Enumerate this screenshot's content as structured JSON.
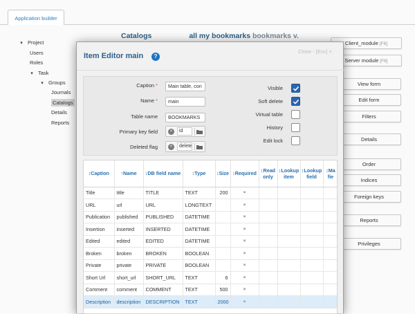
{
  "app": {
    "tab_label": "Application builder"
  },
  "tree": {
    "items": [
      {
        "label": "Project",
        "toggle": "▾",
        "level": 0
      },
      {
        "label": "Users",
        "toggle": "",
        "level": 1
      },
      {
        "label": "Roles",
        "toggle": "",
        "level": 1
      },
      {
        "label": "Task",
        "toggle": "▾",
        "level": 1
      },
      {
        "label": "Groups",
        "toggle": "▾",
        "level": 2
      },
      {
        "label": "Journals",
        "toggle": "",
        "level": 3
      },
      {
        "label": "Catalogs",
        "toggle": "",
        "level": 3,
        "selected": true
      },
      {
        "label": "Details",
        "toggle": "",
        "level": 3
      },
      {
        "label": "Reports",
        "toggle": "",
        "level": 3
      }
    ]
  },
  "catalog_header": {
    "title": "Catalogs",
    "caption": "all my bookmarks",
    "name": "bookmarks v."
  },
  "right_buttons": [
    {
      "label": "Client_module",
      "key": "[F8]"
    },
    {
      "label": "Server module",
      "key": "[F8]"
    },
    {
      "label": "View form",
      "key": ""
    },
    {
      "label": "Edit form",
      "key": ""
    },
    {
      "label": "Filters",
      "key": ""
    },
    {
      "label": "Details",
      "key": ""
    },
    {
      "label": "Order",
      "key": ""
    },
    {
      "label": "Indices",
      "key": ""
    },
    {
      "label": "Foreign keys",
      "key": ""
    },
    {
      "label": "Reports",
      "key": ""
    },
    {
      "label": "Privileges",
      "key": ""
    }
  ],
  "modal": {
    "title": "Item Editor main",
    "help_glyph": "?",
    "close_label": "Close - [Esc] ×",
    "form": {
      "caption_label": "Caption",
      "caption_value": "Main table, con",
      "name_label": "Name",
      "name_value": "main",
      "table_name_label": "Table name",
      "table_name_value": "BOOKMARKS",
      "pk_label": "Primary key field",
      "pk_value": "id",
      "deleted_flag_label": "Deleted flag",
      "deleted_flag_value": "delete",
      "required_mark": "*",
      "clear_glyph": "×",
      "visible_label": "Visible",
      "visible_checked": true,
      "soft_delete_label": "Soft delete",
      "soft_delete_checked": true,
      "virtual_table_label": "Virtual table",
      "virtual_table_checked": false,
      "history_label": "History",
      "history_checked": false,
      "edit_lock_label": "Edit lock",
      "edit_lock_checked": false
    },
    "grid": {
      "columns": [
        "↕Caption",
        "↑Name",
        "↕DB field name",
        "↕Type",
        "↕Size",
        "↕Required",
        "↕Read only",
        "↕Lookup item",
        "↕Lookup field",
        "↕Ma fie"
      ],
      "rows": [
        {
          "caption": "Title",
          "name": "title",
          "db": "TITLE",
          "type": "TEXT",
          "size": "200",
          "required": "×"
        },
        {
          "caption": "URL",
          "name": "url",
          "db": "URL",
          "type": "LONGTEXT",
          "size": "",
          "required": "×"
        },
        {
          "caption": "Publication",
          "name": "published",
          "db": "PUBLISHED",
          "type": "DATETIME",
          "size": "",
          "required": "×"
        },
        {
          "caption": "Insertion",
          "name": "inserted",
          "db": "INSERTED",
          "type": "DATETIME",
          "size": "",
          "required": "×"
        },
        {
          "caption": "Edited",
          "name": "edited",
          "db": "EDITED",
          "type": "DATETIME",
          "size": "",
          "required": "×"
        },
        {
          "caption": "Broken",
          "name": "broken",
          "db": "BROKEN",
          "type": "BOOLEAN",
          "size": "",
          "required": "×"
        },
        {
          "caption": "Private",
          "name": "private",
          "db": "PRIVATE",
          "type": "BOOLEAN",
          "size": "",
          "required": "×"
        },
        {
          "caption": "Short Url",
          "name": "short_url",
          "db": "SHORT_URL",
          "type": "TEXT",
          "size": "6",
          "required": "×"
        },
        {
          "caption": "Comment",
          "name": "comment",
          "db": "COMMENT",
          "type": "TEXT",
          "size": "500",
          "required": "×"
        },
        {
          "caption": "Description",
          "name": "description",
          "db": "DESCRIPTION",
          "type": "TEXT",
          "size": "2000",
          "required": "×",
          "selected": true
        }
      ]
    }
  },
  "colors": {
    "accent": "#2a6fb0",
    "header_text": "#2d5f8b",
    "checkbox_on": "#2a66b0",
    "selected_row": "#dcecf8"
  }
}
